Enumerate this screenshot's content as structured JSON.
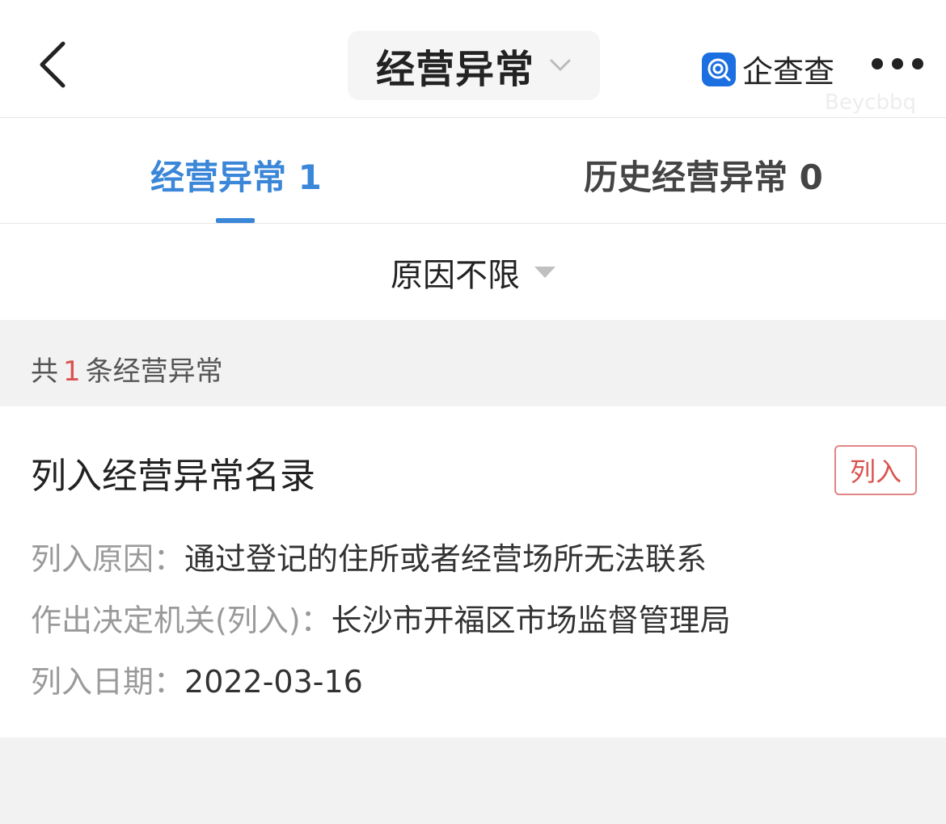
{
  "header": {
    "title": "经营异常",
    "brand_name": "企查查",
    "watermark": "Beycbbq"
  },
  "tabs": [
    {
      "label": "经营异常 1",
      "active": true
    },
    {
      "label": "历史经营异常 0",
      "active": false
    }
  ],
  "filter": {
    "label": "原因不限"
  },
  "summary": {
    "prefix": "共",
    "count": "1",
    "suffix": "条经营异常"
  },
  "record": {
    "title": "列入经营异常名录",
    "tag": "列入",
    "fields": [
      {
        "key": "列入原因：",
        "value": "通过登记的住所或者经营场所无法联系"
      },
      {
        "key": "作出决定机关(列入)：",
        "value": "长沙市开福区市场监督管理局"
      },
      {
        "key": "列入日期：",
        "value": "2022-03-16"
      }
    ]
  },
  "colors": {
    "accent": "#3a86d8",
    "highlight": "#d9534f",
    "background": "#f2f2f2"
  }
}
